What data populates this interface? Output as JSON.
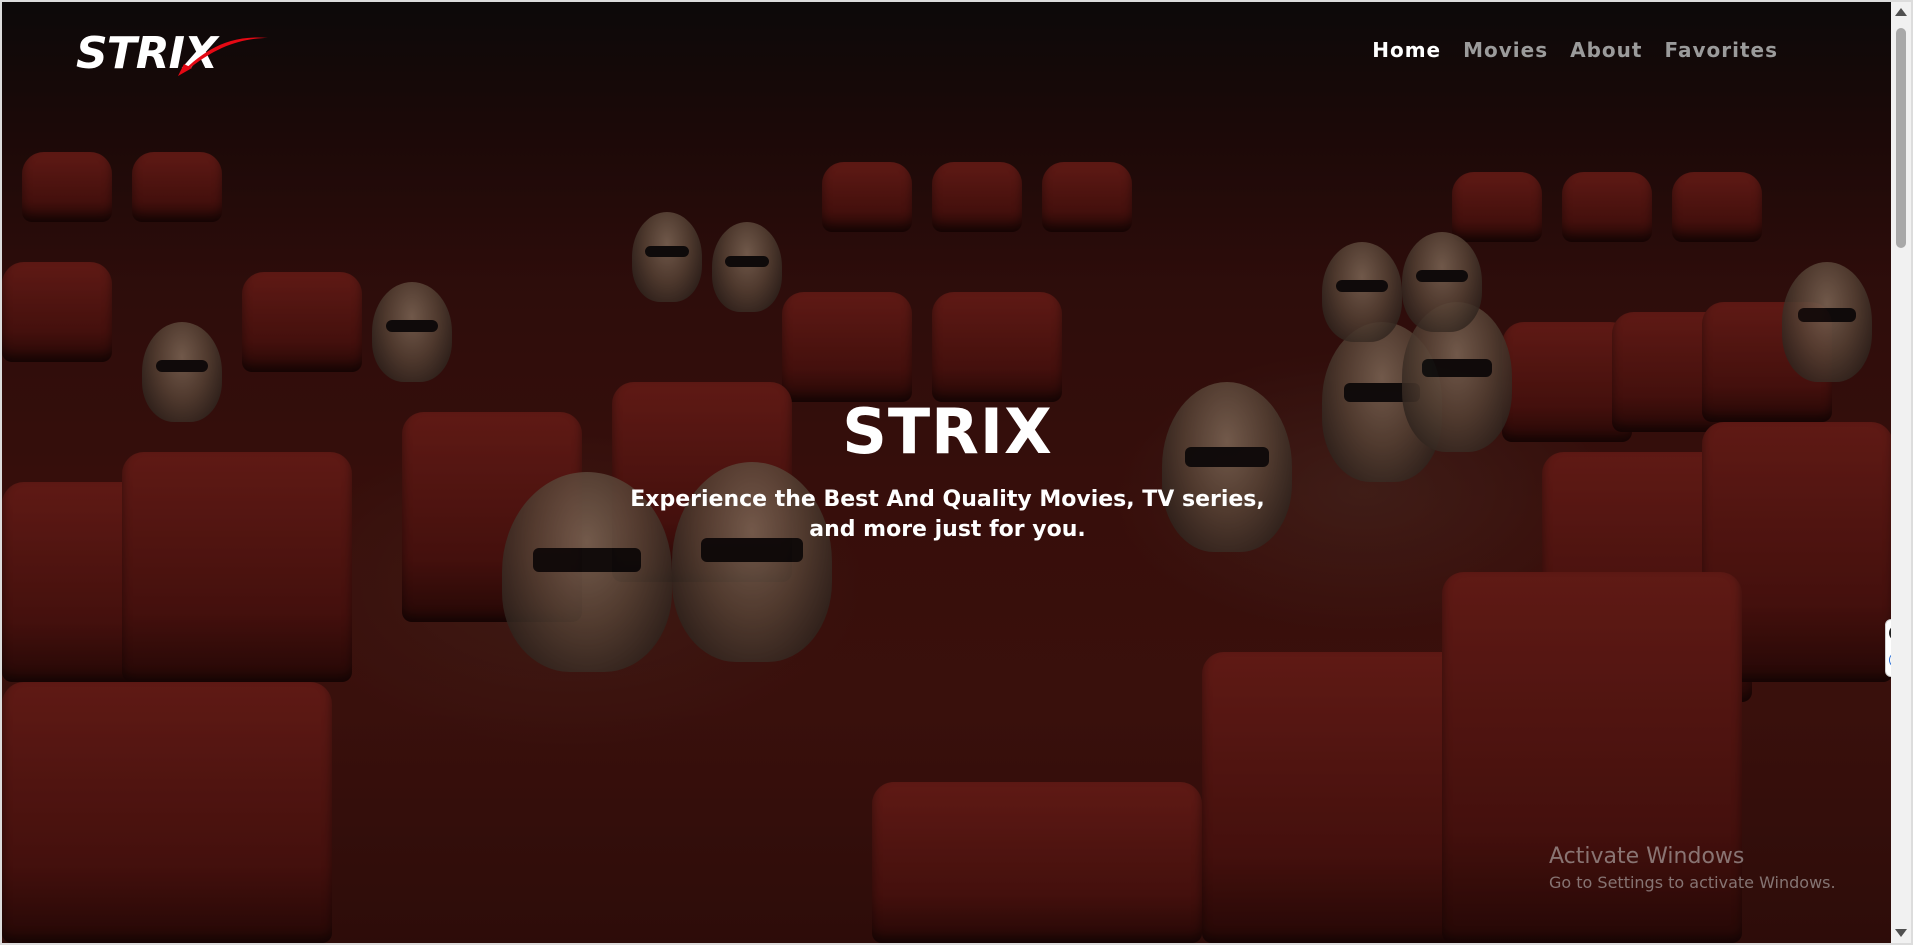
{
  "brand": {
    "logo_text": "STRIX",
    "accent_color": "#e50914"
  },
  "nav": {
    "items": [
      {
        "label": "Home",
        "active": true
      },
      {
        "label": "Movies",
        "active": false
      },
      {
        "label": "About",
        "active": false
      },
      {
        "label": "Favorites",
        "active": false
      }
    ]
  },
  "hero": {
    "title": "STRIX",
    "subtitle_line1": "Experience the Best And Quality Movies, TV series,",
    "subtitle_line2": "and more just for you.",
    "background_image": "cinema-audience-3d-glasses"
  },
  "watermark": {
    "title": "Activate Windows",
    "subtitle": "Go to Settings to activate Windows."
  },
  "side_widget": {
    "close_icon": "close-icon",
    "translate_icon": "translate-icon"
  }
}
